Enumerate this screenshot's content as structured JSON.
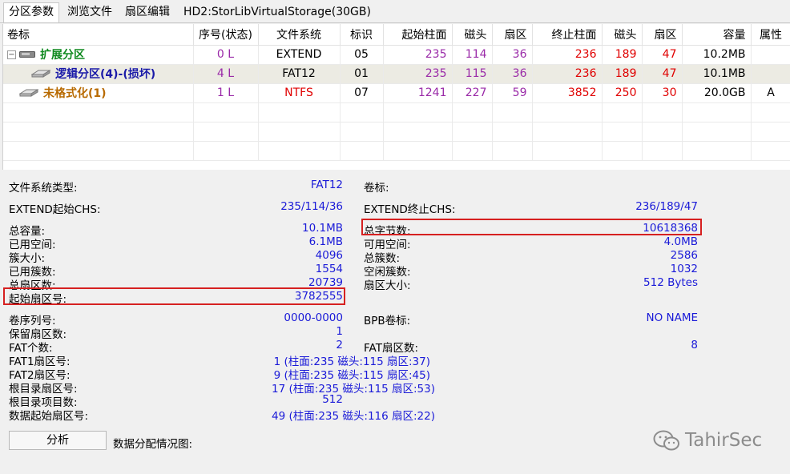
{
  "tabs": [
    {
      "label": "分区参数",
      "active": true
    },
    {
      "label": "浏览文件",
      "active": false
    },
    {
      "label": "扇区编辑",
      "active": false
    },
    {
      "label": "HD2:StorLibVirtualStorage(30GB)",
      "active": false
    }
  ],
  "columns": [
    "卷标",
    "序号(状态)",
    "文件系统",
    "标识",
    "起始柱面",
    "磁头",
    "扇区",
    "终止柱面",
    "磁头",
    "扇区",
    "容量",
    "属性"
  ],
  "rows": [
    {
      "expander": "−",
      "name": "扩展分区",
      "index": "0 L",
      "fs": "EXTEND",
      "id": "05",
      "start_cyl": "235",
      "start_head": "114",
      "start_sec": "36",
      "end_cyl": "236",
      "end_head": "189",
      "end_sec": "47",
      "size": "10.2MB",
      "attr": ""
    },
    {
      "name": "逻辑分区(4)-(损坏)",
      "index": "4 L",
      "fs": "FAT12",
      "id": "01",
      "start_cyl": "235",
      "start_head": "115",
      "start_sec": "36",
      "end_cyl": "236",
      "end_head": "189",
      "end_sec": "47",
      "size": "10.1MB",
      "attr": ""
    },
    {
      "name": "未格式化(1)",
      "index": "1 L",
      "fs": "NTFS",
      "id": "07",
      "start_cyl": "1241",
      "start_head": "227",
      "start_sec": "59",
      "end_cyl": "3852",
      "end_head": "250",
      "end_sec": "30",
      "size": "20.0GB",
      "attr": "A"
    }
  ],
  "info": {
    "fs_type_label": "文件系统类型:",
    "fs_type": "FAT12",
    "volume_label_label": "卷标:",
    "volume_label": "",
    "start_chs_label": "EXTEND起始CHS:",
    "start_chs": "235/114/36",
    "end_chs_label": "EXTEND终止CHS:",
    "end_chs": "236/189/47",
    "total_capacity_label": "总容量:",
    "total_capacity": "10.1MB",
    "total_bytes_label": "总字节数:",
    "total_bytes": "10618368",
    "used_space_label": "已用空间:",
    "used_space": "6.1MB",
    "free_space_label": "可用空间:",
    "free_space": "4.0MB",
    "cluster_size_label": "簇大小:",
    "cluster_size": "4096",
    "total_clusters_label": "总簇数:",
    "total_clusters": "2586",
    "used_clusters_label": "已用簇数:",
    "used_clusters": "1554",
    "free_clusters_label": "空闲簇数:",
    "free_clusters": "1032",
    "total_sectors_label": "总扇区数:",
    "total_sectors": "20739",
    "sector_size_label": "扇区大小:",
    "sector_size": "512 Bytes",
    "start_sector_label": "起始扇区号:",
    "start_sector": "3782555",
    "serial_label": "卷序列号:",
    "serial": "0000-0000",
    "bpb_label_label": "BPB卷标:",
    "bpb_label": "NO NAME",
    "reserved_label": "保留扇区数:",
    "reserved": "1",
    "fat_count_label": "FAT个数:",
    "fat_count": "2",
    "fat_sectors_label": "FAT扇区数:",
    "fat_sectors": "8",
    "fat1_label": "FAT1扇区号:",
    "fat1": "1 (柱面:235 磁头:115 扇区:37)",
    "fat2_label": "FAT2扇区号:",
    "fat2": "9 (柱面:235 磁头:115 扇区:45)",
    "root_sector_label": "根目录扇区号:",
    "root_sector": "17 (柱面:235 磁头:115 扇区:53)",
    "root_entries_label": "根目录项目数:",
    "root_entries": "512",
    "data_start_label": "数据起始扇区号:",
    "data_start": "49 (柱面:235 磁头:116 扇区:22)"
  },
  "analyze_button": "分析",
  "allocation_label": "数据分配情况图:",
  "watermark": "TahirSec",
  "colors": {
    "value_blue": "#1a1ad8",
    "highlight_red": "#d62020",
    "red": "#e00000",
    "purple": "#9a2aa8",
    "extend_green": "#108a20",
    "logical_blue": "#1a1aa8",
    "unformatted_orange": "#b86a00"
  }
}
